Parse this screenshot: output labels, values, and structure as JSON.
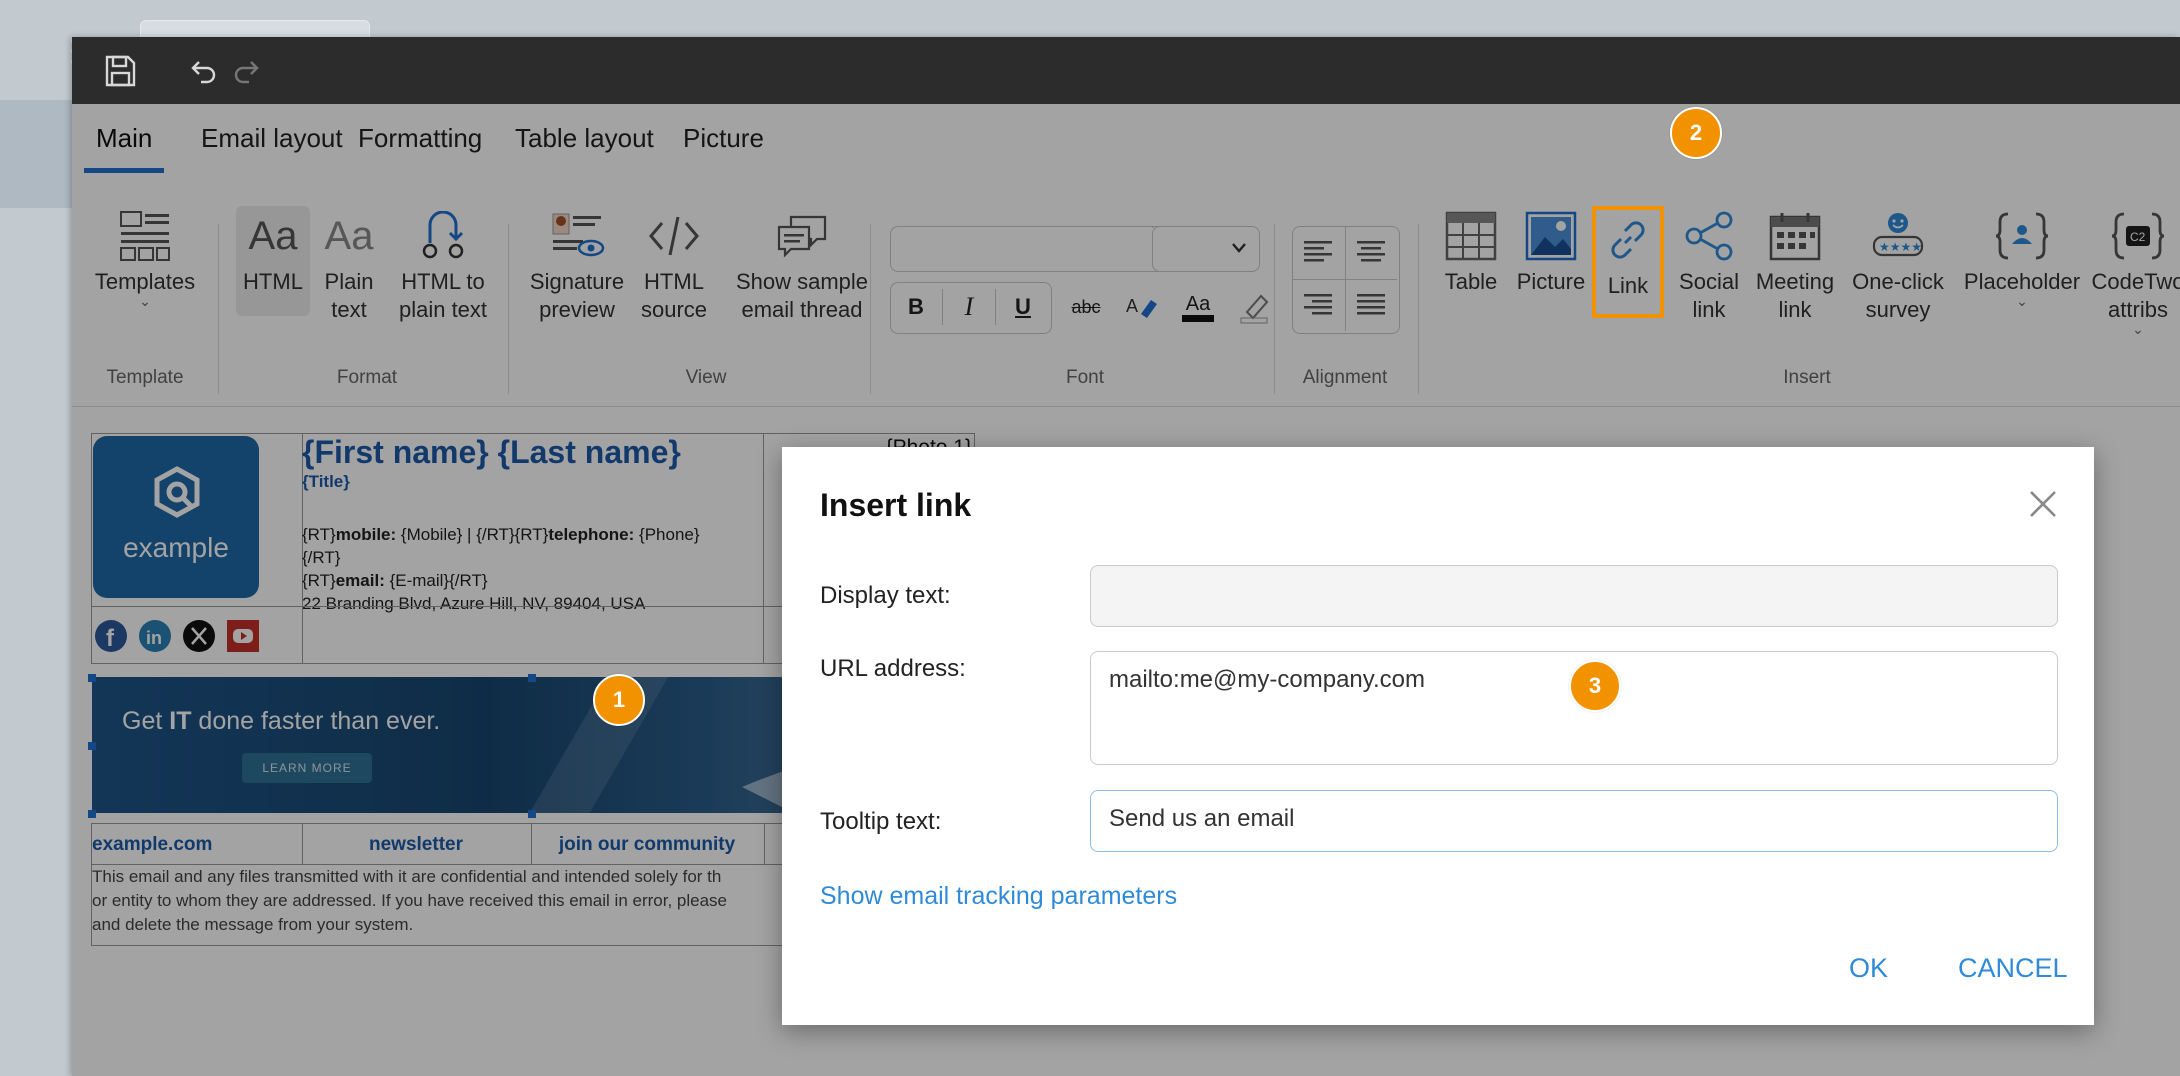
{
  "app": {
    "titlebar": {
      "save_icon": "save-icon",
      "undo_icon": "undo-icon",
      "redo_icon": "redo-icon"
    },
    "tabs": [
      {
        "label": "Main",
        "active": true
      },
      {
        "label": "Email layout"
      },
      {
        "label": "Formatting"
      },
      {
        "label": "Table layout"
      },
      {
        "label": "Picture"
      }
    ],
    "ribbon": {
      "template_group": {
        "label": "Template",
        "templates": "Templates"
      },
      "format_group": {
        "label": "Format",
        "html": "HTML",
        "plain_line1": "Plain",
        "plain_line2": "text",
        "h2p_line1": "HTML to",
        "h2p_line2": "plain text"
      },
      "view_group": {
        "label": "View",
        "sig_line1": "Signature",
        "sig_line2": "preview",
        "src_line1": "HTML",
        "src_line2": "source",
        "thread_line1": "Show sample",
        "thread_line2": "email thread"
      },
      "font_group": {
        "label": "Font",
        "bold": "B",
        "italic": "I",
        "underline": "U",
        "strike": "abc",
        "fontsize": "Aa"
      },
      "alignment_group": {
        "label": "Alignment"
      },
      "insert_group": {
        "label": "Insert",
        "table": "Table",
        "picture": "Picture",
        "link": "Link",
        "social_line1": "Social",
        "social_line2": "link",
        "meeting_line1": "Meeting",
        "meeting_line2": "link",
        "survey_line1": "One-click",
        "survey_line2": "survey",
        "placeholder": "Placeholder",
        "codetwo_line1": "CodeTwo",
        "codetwo_line2": "attribs"
      }
    }
  },
  "signature": {
    "logo_text": "example",
    "name": "{First name} {Last name}",
    "title": "{Title}",
    "photo": "{Photo 1}",
    "line1_pre": "{RT}",
    "line1_mobile_label": "mobile:",
    "line1_mobile": " {Mobile}  |  {/RT}{RT}",
    "line1_tel_label": "telephone:",
    "line1_tel": " {Phone}",
    "line2": "{/RT}",
    "line3_pre": "{RT}",
    "line3_email_label": "email:",
    "line3_email": " {E-mail}{/RT}",
    "address": "22 Branding Blvd, Azure Hill, NV, 89404, USA",
    "banner_text_pre": "Get ",
    "banner_text_bold": "IT",
    "banner_text_post": " done faster than ever.",
    "banner_button": "LEARN MORE",
    "footer_links": [
      "example.com",
      "newsletter",
      "join our community"
    ],
    "disclaimer_line1": "This email and any files transmitted with it are confidential and intended solely for th",
    "disclaimer_line2": "or entity to whom they are addressed. If you have received this email in error, please",
    "disclaimer_line3": "and delete the message from your system.",
    "social_icons": [
      "facebook-icon",
      "linkedin-icon",
      "x-icon",
      "youtube-icon"
    ]
  },
  "dialog": {
    "title": "Insert link",
    "display_text_label": "Display text:",
    "display_text_value": "",
    "url_label": "URL address:",
    "url_value": "mailto:me@my-company.com",
    "tooltip_label": "Tooltip text:",
    "tooltip_value": "Send us an email",
    "tracking_link": "Show email tracking parameters",
    "ok": "OK",
    "cancel": "CANCEL"
  },
  "markers": [
    "1",
    "2",
    "3"
  ],
  "colors": {
    "accent": "#1f6fd2",
    "marker": "#f39200",
    "link": "#2f8ad8",
    "name": "#1c5aa8"
  }
}
